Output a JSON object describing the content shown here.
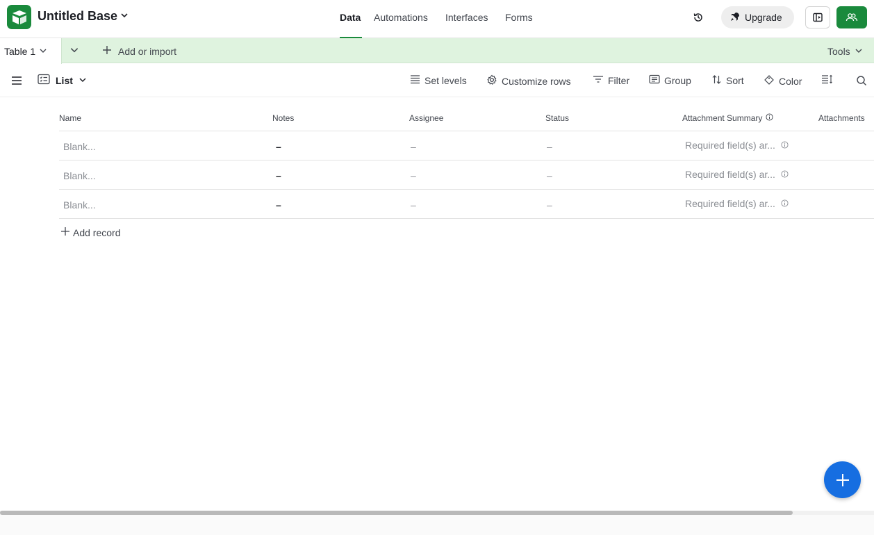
{
  "header": {
    "base_title": "Untitled Base",
    "nav": [
      "Data",
      "Automations",
      "Interfaces",
      "Forms"
    ],
    "active_nav": "Data",
    "upgrade_label": "Upgrade",
    "accent_color": "#1a8a3c"
  },
  "tabs": {
    "active_table": "Table 1",
    "add_import_label": "Add or import",
    "tools_label": "Tools"
  },
  "view_toolbar": {
    "view_name": "List",
    "set_levels": "Set levels",
    "customize_rows": "Customize rows",
    "filter": "Filter",
    "group": "Group",
    "sort": "Sort",
    "color": "Color"
  },
  "list": {
    "columns": [
      "Name",
      "Notes",
      "Assignee",
      "Status",
      "Attachment Summary",
      "Attachments"
    ],
    "rows": [
      {
        "name": "Blank...",
        "notes": "–",
        "assignee": "–",
        "status": "–",
        "summary": "Required field(s) ar..."
      },
      {
        "name": "Blank...",
        "notes": "–",
        "assignee": "–",
        "status": "–",
        "summary": "Required field(s) ar..."
      },
      {
        "name": "Blank...",
        "notes": "–",
        "assignee": "–",
        "status": "–",
        "summary": "Required field(s) ar..."
      }
    ],
    "add_record_label": "Add record"
  },
  "icons": {
    "logo": "airtable-logo-icon",
    "history": "history-icon",
    "upgrade": "rocket-icon",
    "share": "share-panel-icon",
    "collaborators": "users-icon",
    "fab": "plus-icon"
  },
  "colors": {
    "tabs_bar": "#dff3df",
    "fab": "#166ee1"
  }
}
